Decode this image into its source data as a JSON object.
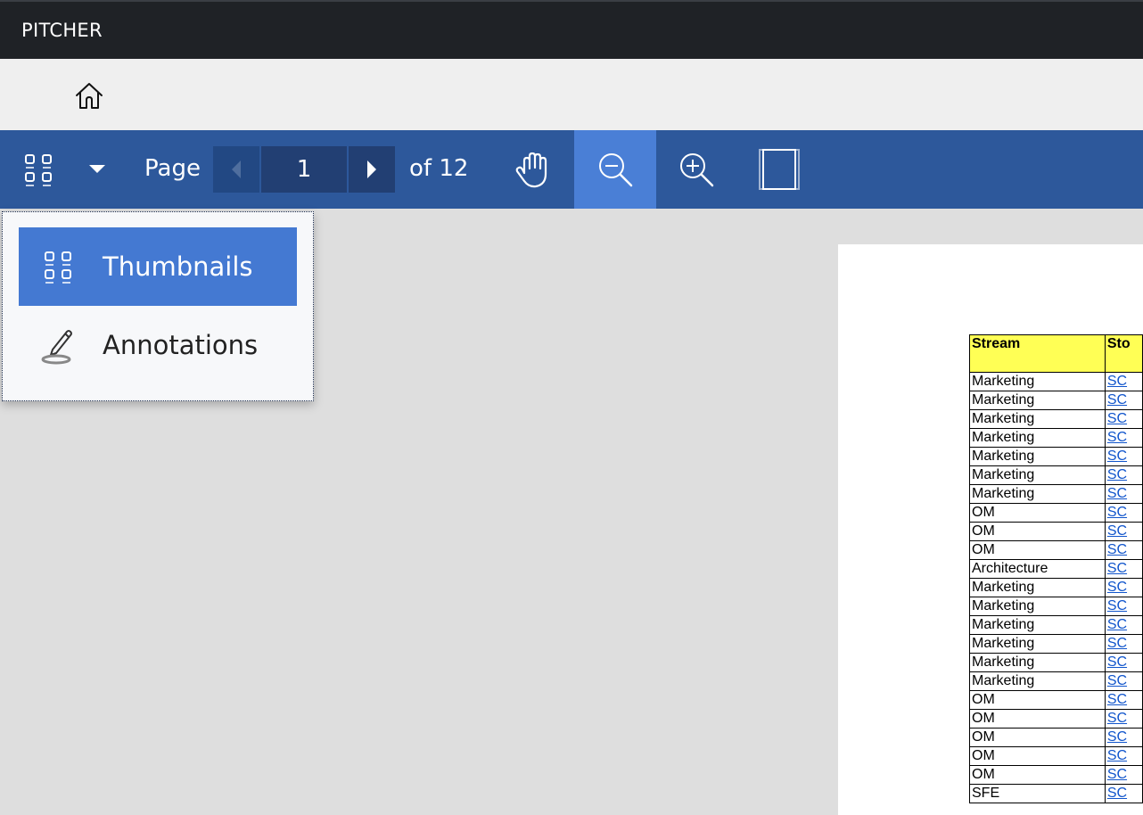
{
  "app": {
    "title": "PITCHER"
  },
  "nav": {
    "home_icon": "home-icon"
  },
  "toolbar": {
    "page_label": "Page",
    "current_page": "1",
    "total_label": "of 12",
    "icons": [
      "thumbnails-icon",
      "chevron-down-icon",
      "triangle-left-icon",
      "triangle-right-icon",
      "hand-pan-icon",
      "zoom-out-icon",
      "zoom-in-icon",
      "fit-page-icon"
    ]
  },
  "menu": {
    "items": [
      {
        "label": "Thumbnails",
        "icon": "thumbnails-icon",
        "selected": true
      },
      {
        "label": "Annotations",
        "icon": "pen-annotation-icon",
        "selected": false
      }
    ]
  },
  "document": {
    "table": {
      "headers": [
        "Stream",
        "Sto"
      ],
      "rows": [
        [
          "Marketing",
          "SC"
        ],
        [
          "Marketing",
          "SC"
        ],
        [
          "Marketing",
          "SC"
        ],
        [
          "Marketing",
          "SC"
        ],
        [
          "Marketing",
          "SC"
        ],
        [
          "Marketing",
          "SC"
        ],
        [
          "Marketing",
          "SC"
        ],
        [
          "OM",
          "SC"
        ],
        [
          "OM",
          "SC"
        ],
        [
          "OM",
          "SC"
        ],
        [
          "Architecture",
          "SC"
        ],
        [
          "Marketing",
          "SC"
        ],
        [
          "Marketing",
          "SC"
        ],
        [
          "Marketing",
          "SC"
        ],
        [
          "Marketing",
          "SC"
        ],
        [
          "Marketing",
          "SC"
        ],
        [
          "Marketing",
          "SC"
        ],
        [
          "OM",
          "SC"
        ],
        [
          "OM",
          "SC"
        ],
        [
          "OM",
          "SC"
        ],
        [
          "OM",
          "SC"
        ],
        [
          "OM",
          "SC"
        ],
        [
          "SFE",
          "SC"
        ]
      ]
    }
  },
  "colors": {
    "titlebar": "#1f2226",
    "toolbar": "#2d589b",
    "active_tool": "#4a7fd6",
    "menu_selected": "#4479d2",
    "table_header": "#ffff55"
  }
}
